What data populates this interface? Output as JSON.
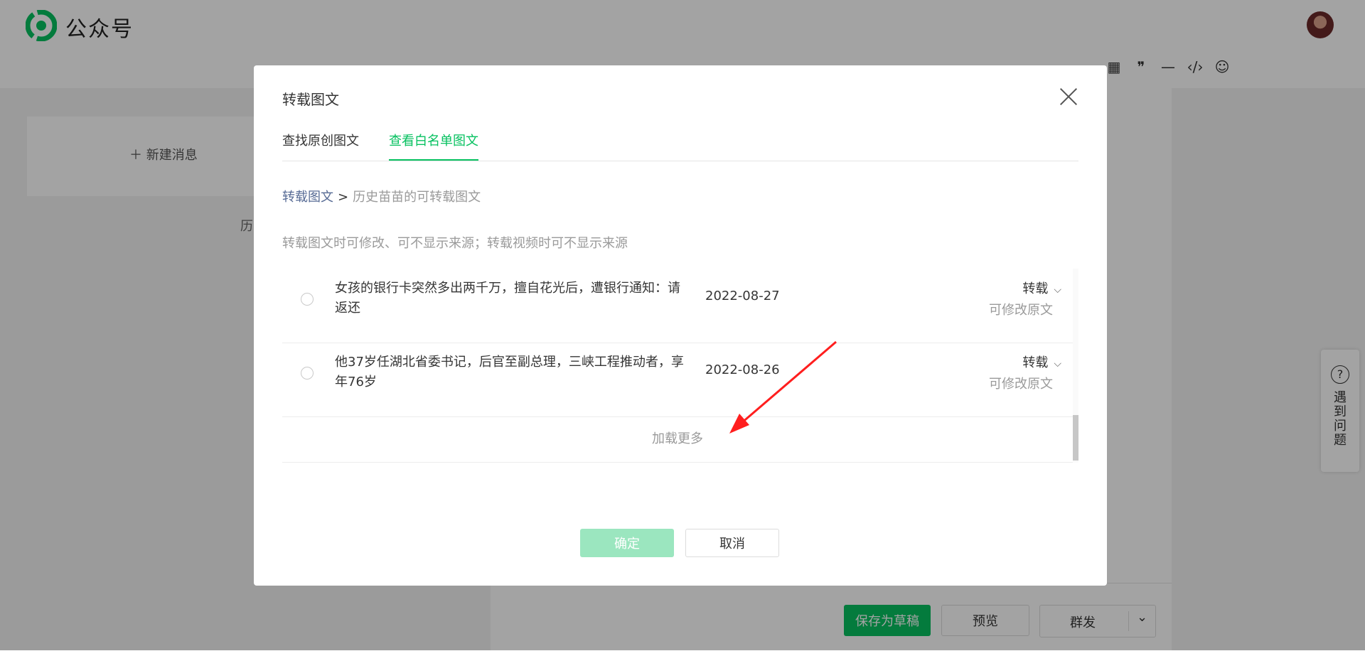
{
  "app": {
    "brand": "公众号"
  },
  "background": {
    "new_message": "新建消息",
    "history_fragment": "历",
    "buttons": {
      "save_draft": "保存为草稿",
      "preview": "预览",
      "mass_send": "群发"
    },
    "help": {
      "text": "遇到问题",
      "icon": "question-icon"
    },
    "toolbar_icons": [
      "table-icon",
      "quote-icon",
      "divider-icon",
      "code-icon",
      "emoji-icon"
    ]
  },
  "modal": {
    "title": "转载图文",
    "tabs": [
      {
        "label": "查找原创图文",
        "active": false
      },
      {
        "label": "查看白名单图文",
        "active": true
      }
    ],
    "breadcrumb": {
      "root": "转载图文",
      "separator": ">",
      "current": "历史苗苗的可转载图文"
    },
    "tip": "转载图文时可修改、可不显示来源；转载视频时可不显示来源",
    "articles": [
      {
        "title": "女孩的银行卡突然多出两千万，擅自花光后，遭银行通知：请返还",
        "date": "2022-08-27",
        "action": "转载",
        "note": "可修改原文"
      },
      {
        "title": "他37岁任湖北省委书记，后官至副总理，三峡工程推动者，享年76岁",
        "date": "2022-08-26",
        "action": "转载",
        "note": "可修改原文"
      }
    ],
    "load_more": "加载更多",
    "confirm": "确定",
    "cancel": "取消"
  },
  "colors": {
    "accent": "#07c160",
    "link": "#576b95",
    "annotation_arrow": "#ff1e1e"
  }
}
